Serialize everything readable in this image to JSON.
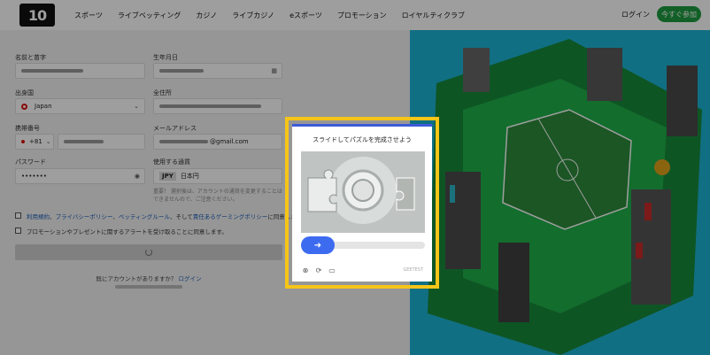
{
  "header": {
    "logo": "10",
    "nav": [
      "スポーツ",
      "ライブベッティング",
      "カジノ",
      "ライブカジノ",
      "eスポーツ",
      "プロモーション",
      "ロイヤルティクラブ"
    ],
    "login": "ログイン",
    "join": "今すぐ参加"
  },
  "form": {
    "name_label": "名前と苗字",
    "dob_label": "生年月日",
    "country_label": "出身国",
    "country_value": "Japan",
    "address_label": "全住所",
    "phone_label": "携帯番号",
    "phone_code": "+81",
    "email_label": "メールアドレス",
    "email_suffix": "@gmail.com",
    "password_label": "パスワード",
    "password_value": "•••••••",
    "currency_label": "使用する通貨",
    "currency_code": "JPY",
    "currency_name": "日本円",
    "currency_hint": "重要！ 選択後は、アカウントの通貨を変更することはできませんので、ご注意ください。",
    "terms_parts": [
      "利用規約",
      "、",
      "プライバシーポリシー",
      "、",
      "ベッティングルール",
      "、そして",
      "責任あるゲーミングポリシー",
      "に同意します。"
    ],
    "promo_consent": "プロモーションやプレゼントに関するアラートを受け取ることに同意します。",
    "already_account": "既にアカウントがありますか？",
    "login_link": "ログイン"
  },
  "captcha": {
    "title": "スライドしてパズルを完成させよう",
    "brand": "GEETEST"
  }
}
